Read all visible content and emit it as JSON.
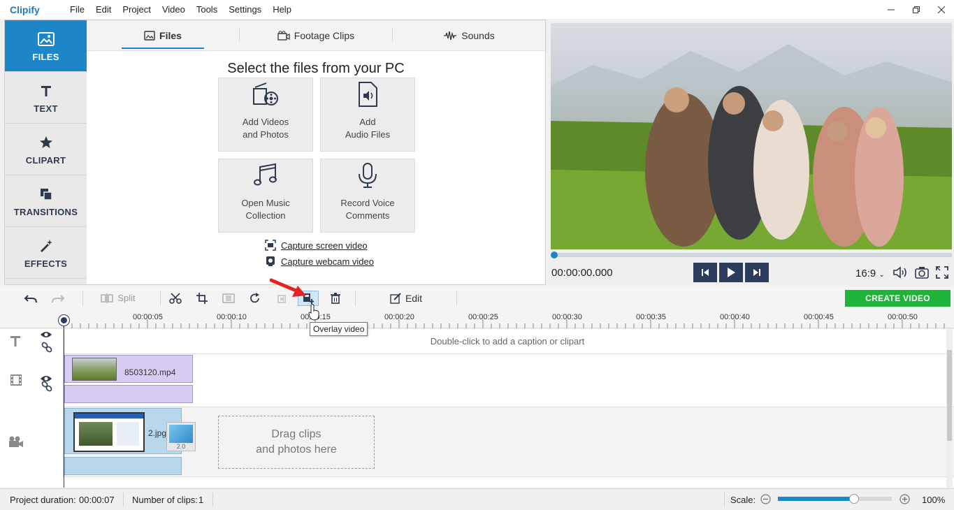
{
  "app": {
    "logo": "Clipify"
  },
  "menu": [
    "File",
    "Edit",
    "Project",
    "Video",
    "Tools",
    "Settings",
    "Help"
  ],
  "sidenav": [
    {
      "label": "FILES",
      "icon": "image-icon",
      "active": true
    },
    {
      "label": "TEXT",
      "icon": "text-icon",
      "active": false
    },
    {
      "label": "CLIPART",
      "icon": "star-icon",
      "active": false
    },
    {
      "label": "TRANSITIONS",
      "icon": "transitions-icon",
      "active": false
    },
    {
      "label": "EFFECTS",
      "icon": "magic-wand-icon",
      "active": false
    }
  ],
  "tabs": [
    {
      "label": "Files",
      "icon": "image-icon",
      "active": true
    },
    {
      "label": "Footage Clips",
      "icon": "film-camera-icon",
      "active": false
    },
    {
      "label": "Sounds",
      "icon": "waveform-icon",
      "active": false
    }
  ],
  "files": {
    "title": "Select the files from your PC",
    "add_videos": [
      "Add Videos",
      "and Photos"
    ],
    "add_audio": [
      "Add",
      "Audio Files"
    ],
    "open_music": [
      "Open Music",
      "Collection"
    ],
    "record_voice": [
      "Record Voice",
      "Comments"
    ],
    "capture_screen": "Capture screen video",
    "capture_webcam": "Capture webcam video"
  },
  "preview": {
    "timecode": "00:00:00.000",
    "aspect_ratio": "16:9",
    "progress": 0
  },
  "toolbar": {
    "split": "Split",
    "edit": "Edit",
    "create_video": "CREATE VIDEO",
    "tooltip": "Overlay video"
  },
  "ruler": [
    "00:00:05",
    "00:00:10",
    "00:00:15",
    "00:00:20",
    "00:00:25",
    "00:00:30",
    "00:00:35",
    "00:00:40",
    "00:00:45",
    "00:00:50"
  ],
  "timeline": {
    "caption_hint": "Double-click to add a caption or clipart",
    "overlay_clip": "8503120.mp4",
    "main_clip": "2.jpg",
    "transition_duration": "2.0",
    "drag_hint": [
      "Drag clips",
      "and photos here"
    ]
  },
  "status": {
    "project_duration_label": "Project duration:",
    "project_duration": "00:00:07",
    "clips_label": "Number of clips:",
    "clips": "1",
    "scale_label": "Scale:",
    "scale": "100%",
    "scale_value": 0.67
  },
  "colors": {
    "accent": "#1c86c8",
    "create": "#1fb33a",
    "dark": "#2b3c5c",
    "overlay_clip": "#d9ccf2",
    "main_clip": "#b7d7ec"
  }
}
